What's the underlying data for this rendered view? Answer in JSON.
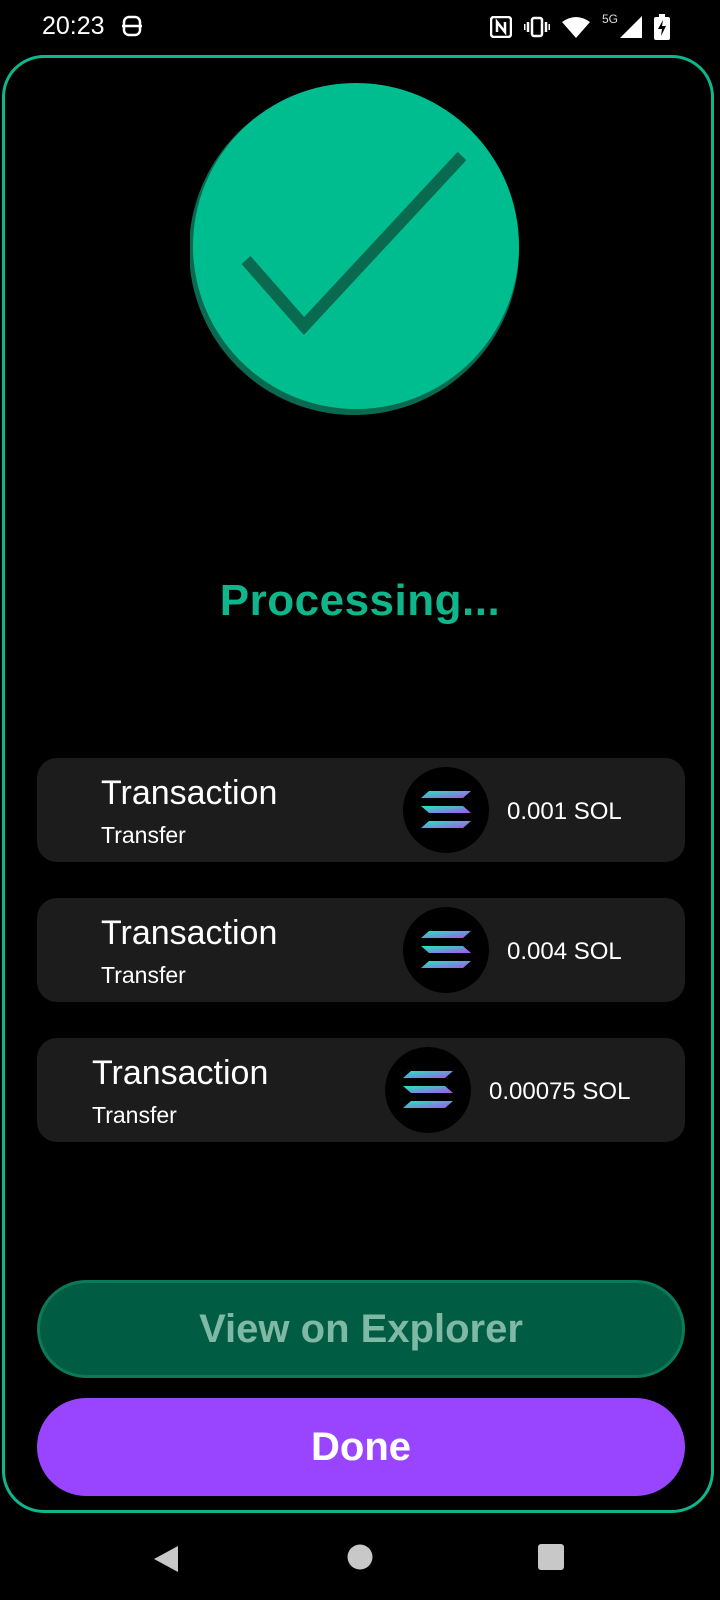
{
  "status_bar": {
    "time": "20:23",
    "network_label": "5G",
    "icons": [
      "s-app-icon",
      "nfc-icon",
      "vibrate-icon",
      "wifi-icon",
      "cellular-icon",
      "battery-charging-icon"
    ]
  },
  "colors": {
    "accent_green": "#0fb68c",
    "button_dark_green": "#005d43",
    "button_purple": "#9945ff",
    "card_bg": "#1c1c1c"
  },
  "status": {
    "icon": "checkmark-icon",
    "text": "Processing..."
  },
  "transactions": [
    {
      "title": "Transaction",
      "subtitle": "Transfer",
      "icon": "solana-logo-icon",
      "amount": "0.001 SOL"
    },
    {
      "title": "Transaction",
      "subtitle": "Transfer",
      "icon": "solana-logo-icon",
      "amount": "0.004 SOL"
    },
    {
      "title": "Transaction",
      "subtitle": "Transfer",
      "icon": "solana-logo-icon",
      "amount": "0.00075 SOL"
    }
  ],
  "buttons": {
    "explorer": "View on Explorer",
    "done": "Done"
  },
  "nav_bar": {
    "icons": [
      "back-icon",
      "home-icon",
      "recents-icon"
    ]
  }
}
